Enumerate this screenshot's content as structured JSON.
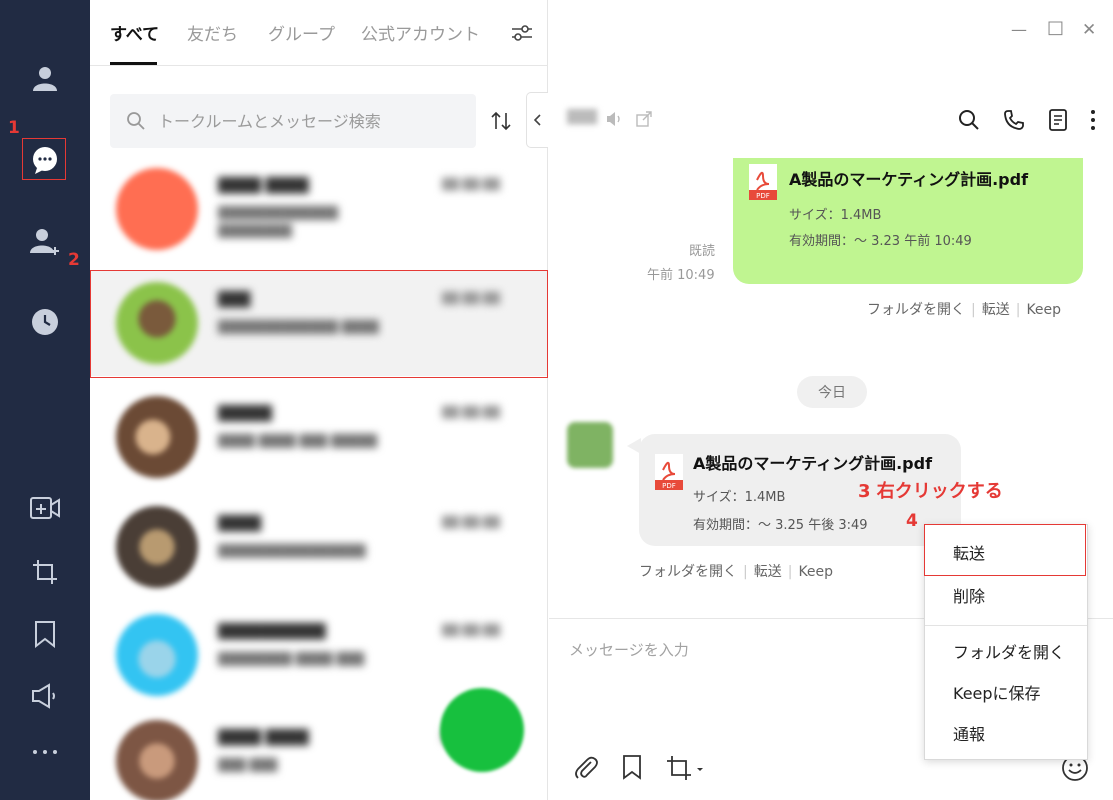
{
  "window": {
    "minimize": "—",
    "maximize": "□",
    "close": "✕"
  },
  "tabs": [
    {
      "label": "すべて",
      "active": true
    },
    {
      "label": "友だち",
      "active": false
    },
    {
      "label": "グループ",
      "active": false
    },
    {
      "label": "公式アカウント",
      "active": false
    }
  ],
  "search": {
    "placeholder": "トークルームとメッセージ検索"
  },
  "chat_list": [
    {
      "name": "████ ████",
      "preview": "█████████████ ████████",
      "time": "██ ██:██",
      "color": "#ff6e52"
    },
    {
      "name": "███",
      "preview": "█████████████ ████",
      "time": "██ ██:██",
      "color": "#8bc34a"
    },
    {
      "name": "█████",
      "preview": "████ ████ ███ █████",
      "time": "██ ██:██",
      "color": "#9c6b4a"
    },
    {
      "name": "████",
      "preview": "████████████████",
      "time": "██ ██:██",
      "color": "#6b5a4e"
    },
    {
      "name": "██████████",
      "preview": "████████ ████ ███",
      "time": "██ ██:██",
      "color": "#33c4f2"
    },
    {
      "name": "████ ████",
      "preview": "███ ███",
      "time": "██ ██:██",
      "color": "#a0705a"
    }
  ],
  "chat": {
    "header_name": "███",
    "messages": {
      "outgoing": {
        "file_name": "A製品のマーケティング計画.pdf",
        "size": "サイズ：1.4MB",
        "expiry": "有効期間：～ 3.23 午前 10:49",
        "read": "既読",
        "time": "午前 10:49",
        "actions": [
          "フォルダを開く",
          "転送",
          "Keep"
        ]
      },
      "date_divider": "今日",
      "incoming": {
        "file_name": "A製品のマーケティング計画.pdf",
        "size": "サイズ：1.4MB",
        "expiry": "有効期間：～ 3.25 午後 3:49",
        "actions": [
          "フォルダを開く",
          "転送",
          "Keep"
        ]
      }
    },
    "compose_placeholder": "メッセージを入力",
    "pdf_label": "PDF"
  },
  "context_menu": {
    "items": [
      "転送",
      "削除",
      "フォルダを開く",
      "Keepに保存",
      "通報"
    ]
  },
  "annotations": {
    "step1": "1",
    "step2": "2",
    "step3_text": "3 右クリックする",
    "step4": "4"
  },
  "colors": {
    "nav_bg": "#212b43",
    "accent_red": "#e53935",
    "bubble_out": "#c0f591",
    "bubble_in": "#efefef",
    "line_green": "#17c03e"
  },
  "icons": {
    "nav": [
      "person-icon",
      "chat-icon",
      "add-friend-icon",
      "clock-icon",
      "video-call-icon",
      "crop-icon",
      "bookmark-icon",
      "announce-icon",
      "more-icon"
    ],
    "header": [
      "mute-icon",
      "popout-icon",
      "search-icon",
      "phone-icon",
      "notes-icon",
      "kebab-icon"
    ],
    "toolbar": [
      "attach-icon",
      "bookmark-icon",
      "crop-dropdown-icon",
      "emoji-icon"
    ]
  }
}
